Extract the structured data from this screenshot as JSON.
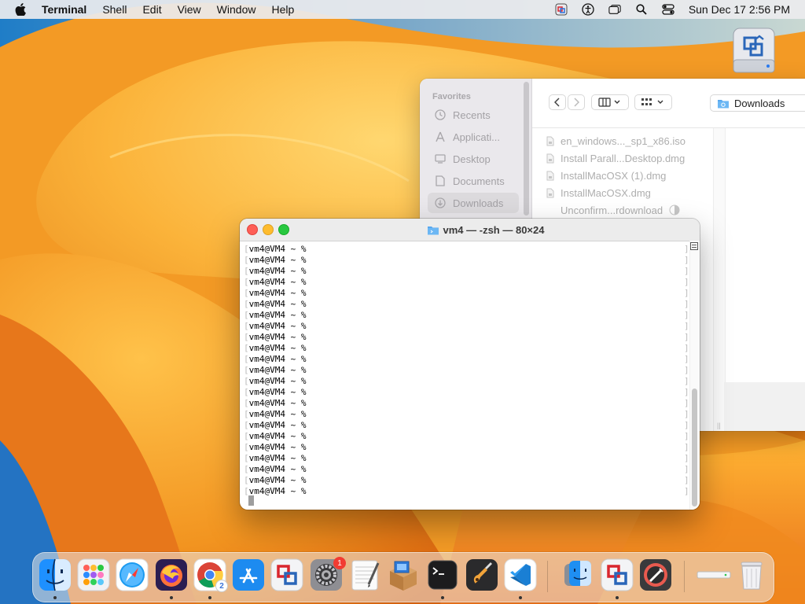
{
  "menubar": {
    "app_name": "Terminal",
    "menus": [
      "Shell",
      "Edit",
      "View",
      "Window",
      "Help"
    ],
    "status_icons": [
      "parallels-icon",
      "accessibility-icon",
      "window-icon",
      "search-icon",
      "control-center-icon"
    ],
    "clock": "Sun Dec 17  2:56 PM"
  },
  "finder": {
    "sidebar_heading": "Favorites",
    "sidebar_items": [
      {
        "label": "Recents",
        "icon": "clock-icon"
      },
      {
        "label": "Applicati...",
        "icon": "applications-icon"
      },
      {
        "label": "Desktop",
        "icon": "desktop-icon"
      },
      {
        "label": "Documents",
        "icon": "document-icon"
      },
      {
        "label": "Downloads",
        "icon": "download-icon",
        "selected": true
      }
    ],
    "path_label": "Downloads",
    "files": [
      "en_windows..._sp1_x86.iso",
      "Install Parall...Desktop.dmg",
      "InstallMacOSX (1).dmg",
      "InstallMacOSX.dmg",
      "Unconfirm...rdownload"
    ]
  },
  "terminal": {
    "title": "vm4 — -zsh — 80×24",
    "prompt": "vm4@VM4 ~ %",
    "line_count": 23
  },
  "dock": {
    "apps": [
      "finder-icon",
      "launchpad-icon",
      "safari-icon",
      "firefox-icon",
      "chrome-icon",
      "app-store-icon",
      "parallels-icon",
      "system-settings-icon",
      "textedit-icon",
      "archive-utility-icon",
      "terminal-icon",
      "garageband-icon",
      "vscode-icon",
      "migration-assistant-icon",
      "parallels-desktop-icon",
      "digital-color-meter-icon",
      "drive-icon",
      "trash-icon"
    ],
    "system_settings_badge": "1",
    "chrome_badge": "2"
  },
  "colors": {
    "accent": "#3a82f7",
    "close": "#fe5f57",
    "minimize": "#febc2e",
    "maximize": "#28c840"
  }
}
